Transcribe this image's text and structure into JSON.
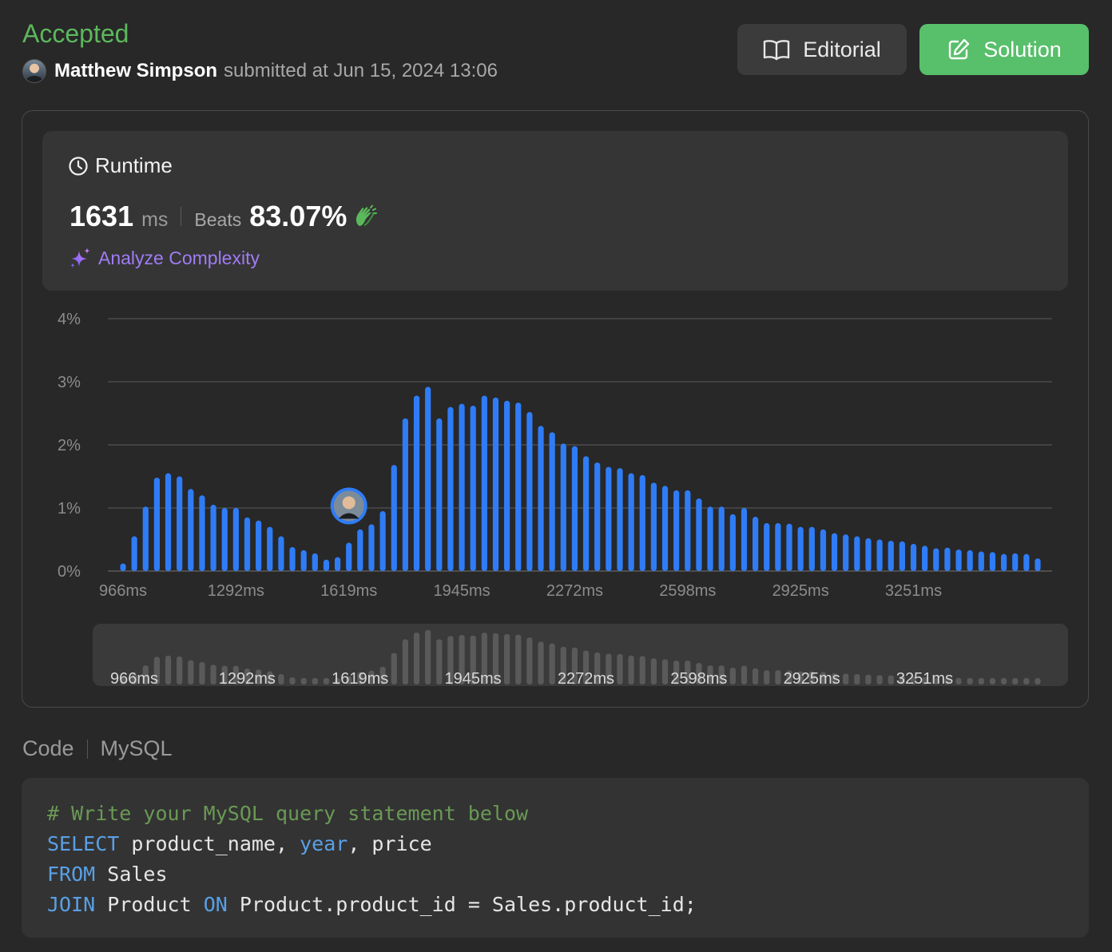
{
  "submission": {
    "status": "Accepted",
    "user_name": "Matthew Simpson",
    "submitted_text": "submitted at Jun 15, 2024 13:06"
  },
  "buttons": {
    "editorial": "Editorial",
    "solution": "Solution"
  },
  "runtime": {
    "title": "Runtime",
    "value": "1631",
    "unit": "ms",
    "beats_label": "Beats",
    "beats_value": "83.07%",
    "analyze_label": "Analyze Complexity"
  },
  "colors": {
    "accent_green": "#5cb85c",
    "bar_blue": "#2f7cf6",
    "analyze_purple": "#9f7cf5"
  },
  "chart_data": {
    "type": "bar",
    "ylim": [
      0,
      4
    ],
    "y_ticks": [
      "0%",
      "1%",
      "2%",
      "3%",
      "4%"
    ],
    "x_tick_labels": [
      "966ms",
      "1292ms",
      "1619ms",
      "1945ms",
      "2272ms",
      "2598ms",
      "2925ms",
      "3251ms"
    ],
    "x_tick_bar_index": [
      0,
      10,
      20,
      30,
      40,
      50,
      60,
      70
    ],
    "user_bar_index": 20,
    "values": [
      0.12,
      0.55,
      1.02,
      1.48,
      1.55,
      1.5,
      1.3,
      1.2,
      1.05,
      1.0,
      1.0,
      0.85,
      0.8,
      0.7,
      0.55,
      0.38,
      0.33,
      0.28,
      0.18,
      0.22,
      0.45,
      0.66,
      0.74,
      0.95,
      1.68,
      2.42,
      2.78,
      2.92,
      2.42,
      2.6,
      2.65,
      2.62,
      2.78,
      2.75,
      2.7,
      2.67,
      2.52,
      2.3,
      2.2,
      2.02,
      1.98,
      1.82,
      1.72,
      1.65,
      1.63,
      1.55,
      1.52,
      1.4,
      1.35,
      1.28,
      1.28,
      1.15,
      1.02,
      1.02,
      0.9,
      1.0,
      0.86,
      0.76,
      0.76,
      0.75,
      0.7,
      0.7,
      0.66,
      0.6,
      0.58,
      0.55,
      0.52,
      0.5,
      0.48,
      0.47,
      0.43,
      0.4,
      0.36,
      0.37,
      0.34,
      0.33,
      0.31,
      0.3,
      0.27,
      0.28,
      0.27,
      0.2
    ]
  },
  "code": {
    "label": "Code",
    "language": "MySQL",
    "lines": [
      [
        {
          "t": "# Write your MySQL query statement below",
          "c": "comment"
        }
      ],
      [
        {
          "t": "SELECT",
          "c": "kw"
        },
        {
          "t": " product_name, ",
          "c": ""
        },
        {
          "t": "year",
          "c": "kw"
        },
        {
          "t": ", price",
          "c": ""
        }
      ],
      [
        {
          "t": "FROM",
          "c": "kw"
        },
        {
          "t": " Sales",
          "c": ""
        }
      ],
      [
        {
          "t": "JOIN",
          "c": "kw"
        },
        {
          "t": " Product ",
          "c": ""
        },
        {
          "t": "ON",
          "c": "kw"
        },
        {
          "t": " Product.product_id = Sales.product_id;",
          "c": ""
        }
      ]
    ]
  }
}
